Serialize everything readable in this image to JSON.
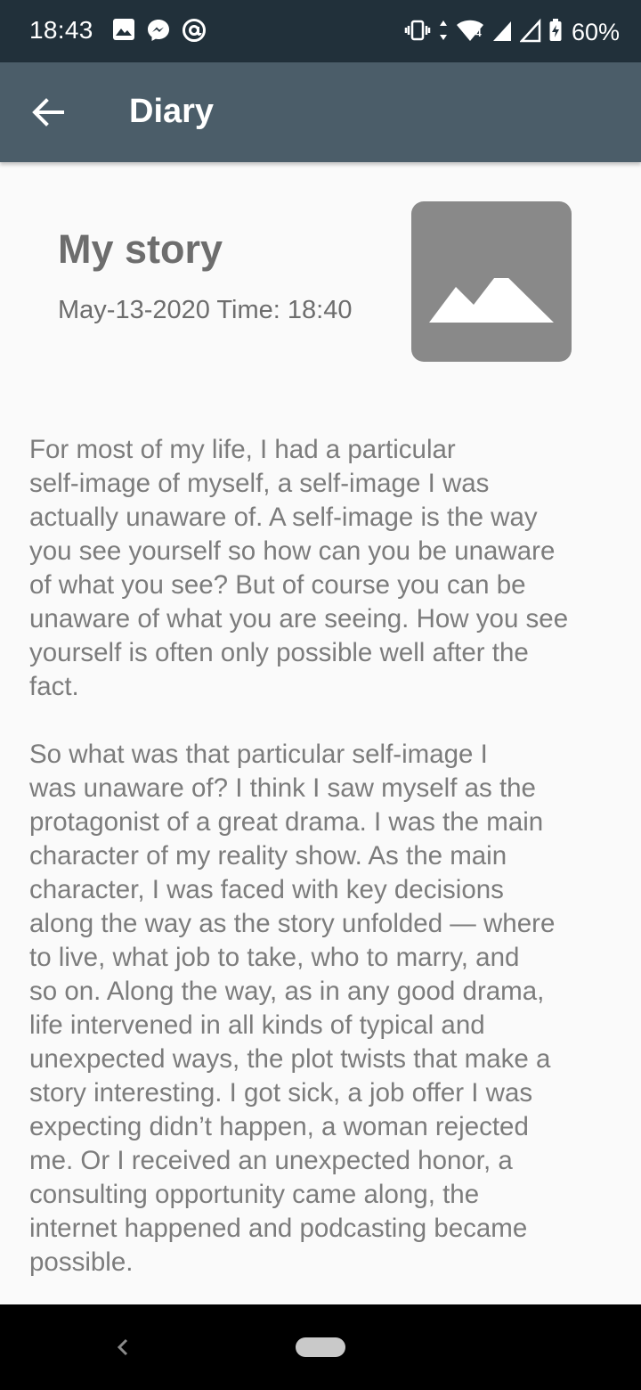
{
  "status_bar": {
    "time": "18:43",
    "left_icons": [
      "image-icon",
      "messenger-icon",
      "at-sign-icon"
    ],
    "right_icons": [
      "vibrate-icon",
      "data-arrows-icon",
      "wifi-icon",
      "signal-icon",
      "signal-no-sim-icon",
      "battery-charging-icon"
    ],
    "wifi_badge": "4",
    "battery_text": "60%"
  },
  "app_bar": {
    "back_icon": "arrow-back-icon",
    "title": "Diary"
  },
  "entry": {
    "title": "My story",
    "date_line": "May-13-2020 Time: 18:40",
    "image_icon": "image-placeholder-icon",
    "body": "For most of my life, I had a particular\nself-image of myself, a self-image I was\nactually unaware of. A self-image is the way\nyou see yourself so how can you be unaware\nof what you see? But of course you can be\nunaware of what you are seeing. How you see\nyourself is often only possible well after the\nfact.\n\nSo what was that particular self-image I\nwas unaware of? I think I saw myself as the\nprotagonist of a great drama. I was the main\ncharacter of my reality show. As the main\ncharacter, I was faced with key decisions\nalong the way as the story unfolded — where\nto live, what job to take, who to marry, and\nso on. Along the way, as in any good drama,\nlife intervened in all kinds of typical and\nunexpected ways, the plot twists that make a\nstory interesting. I got sick, a job offer I was\nexpecting didn’t happen, a woman rejected\nme. Or I received an unexpected honor, a\nconsulting opportunity came along, the\ninternet happened and podcasting became\npossible."
  },
  "nav_bar": {
    "back_icon": "nav-back-icon",
    "home_icon": "nav-home-pill-icon"
  },
  "colors": {
    "status_bar": "#21303a",
    "app_bar": "#4b5d69",
    "background": "#fafafa",
    "title_text": "#6d6d6d",
    "body_text": "#7c7c7c",
    "image_placeholder": "#898989"
  }
}
